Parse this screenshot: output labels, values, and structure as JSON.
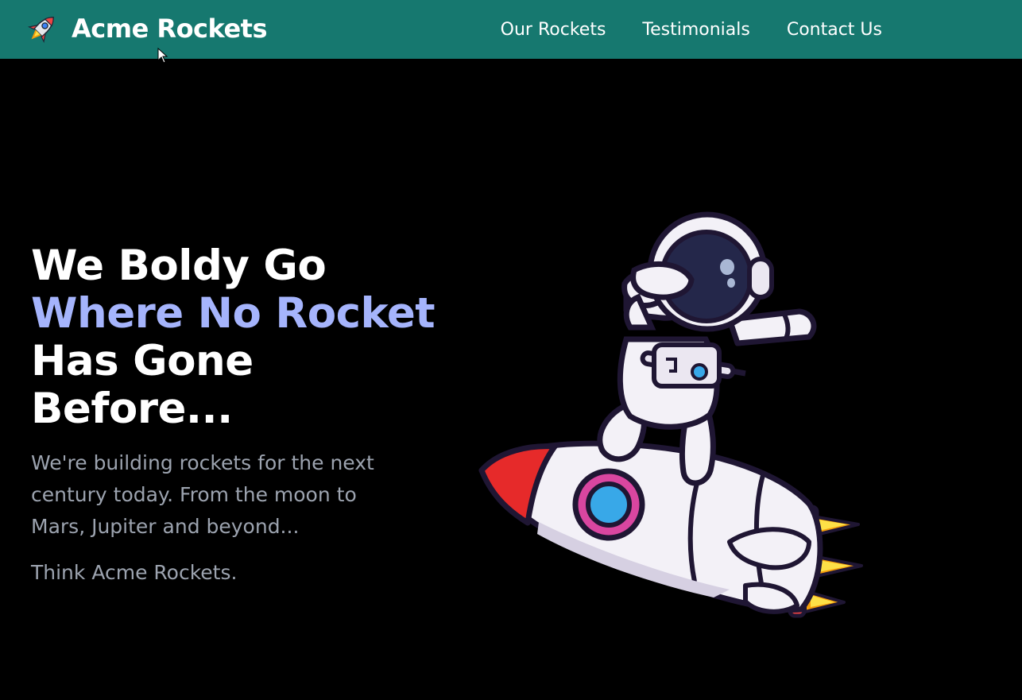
{
  "nav": {
    "brand_name": "Acme Rockets",
    "brand_icon": "rocket-icon",
    "links": [
      {
        "label": "Our Rockets"
      },
      {
        "label": "Testimonials"
      },
      {
        "label": "Contact Us"
      }
    ]
  },
  "hero": {
    "headline_line1": "We Boldy Go",
    "headline_accent": "Where No Rocket",
    "headline_line3": "Has Gone",
    "headline_line4": "Before...",
    "lead": "We're building rockets for the next century today. From the moon to Mars, Jupiter and beyond...",
    "tagline": "Think Acme Rockets.",
    "illustration": "astronaut-on-rocket-illustration"
  },
  "colors": {
    "navbar_bg": "#16786f",
    "page_bg": "#000000",
    "accent_text": "#a5b4fc",
    "muted_text": "#9ca3af"
  }
}
